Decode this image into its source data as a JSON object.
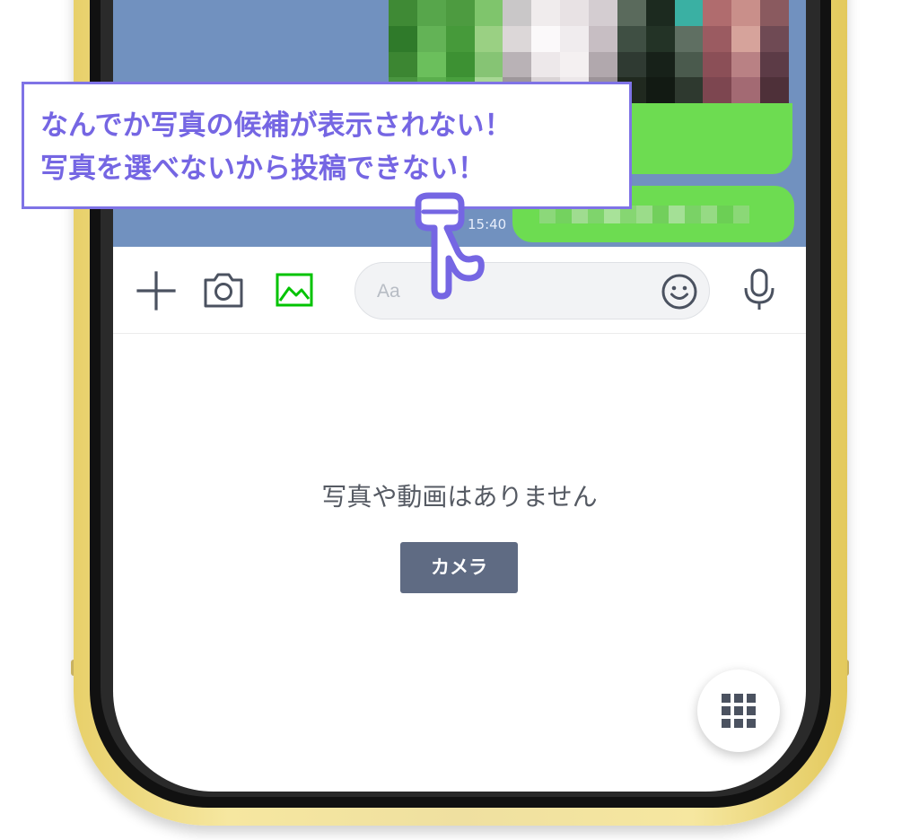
{
  "chat": {
    "timestamp": "15:40",
    "photo_pixels": [
      "#3f8a35",
      "#57a64b",
      "#4d9b40",
      "#7fc56c",
      "#c9c7c8",
      "#f0eced",
      "#e8e2e4",
      "#d4cdd1",
      "#5a6a5c",
      "#1c2a1f",
      "#3ab0a3",
      "#b06c6e",
      "#c98f8a",
      "#8a5a5f",
      "#2f7a2a",
      "#63b356",
      "#469a3a",
      "#9ad083",
      "#dcd7d8",
      "#fbf9fa",
      "#f0ecee",
      "#c7bec3",
      "#3f4f43",
      "#233326",
      "#5f6f62",
      "#9b5b61",
      "#d6a39b",
      "#6f4a54",
      "#3c8632",
      "#6bbf5c",
      "#3d9133",
      "#86c474",
      "#b9b2b6",
      "#ede8ea",
      "#f4f0f1",
      "#b1a8ad",
      "#2f3a32",
      "#172119",
      "#4a5a4d",
      "#8b4f57",
      "#b98184",
      "#5c3b46",
      "#4a9640",
      "#5aae4d",
      "#49a03e",
      "#a7d894",
      "#9e979b",
      "#d9d3d5",
      "#ece7e9",
      "#9c9398",
      "#20291f",
      "#121a13",
      "#2e392f",
      "#7d4650",
      "#a36a73",
      "#4e3039"
    ]
  },
  "input_bar": {
    "placeholder": "Aa"
  },
  "empty_state": {
    "message": "写真や動画はありません",
    "camera_button": "カメラ"
  },
  "callout": {
    "line1": "なんでか写真の候補が表示されない！",
    "line2": "写真を選べないから投稿できない！"
  },
  "colors": {
    "accent_purple": "#7566e3",
    "chat_bg": "#7191bf",
    "bubble_green": "#6ddc51",
    "gallery_icon_green": "#00c300",
    "button_slate": "#5f6b83"
  },
  "icons": {
    "plus": "plus-icon",
    "camera": "camera-icon",
    "gallery": "image-icon",
    "emoji": "smiley-icon",
    "mic": "microphone-icon",
    "keypad": "keypad-grid-icon",
    "pointer": "pointing-hand-icon"
  }
}
